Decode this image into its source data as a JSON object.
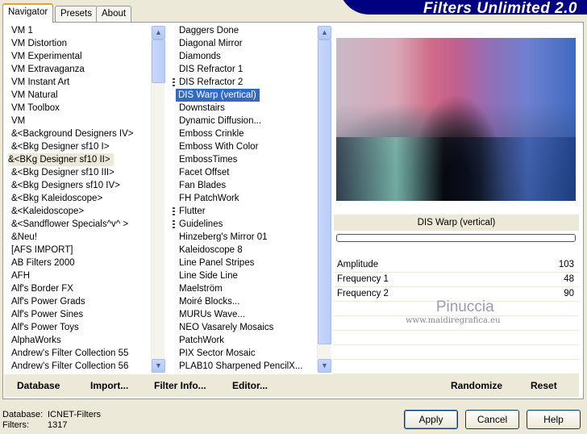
{
  "app_title": "Filters Unlimited 2.0",
  "tabs": [
    {
      "label": "Navigator",
      "active": true
    },
    {
      "label": "Presets"
    },
    {
      "label": "About"
    }
  ],
  "categories": [
    "VM 1",
    "VM Distortion",
    "VM Experimental",
    "VM Extravaganza",
    "VM Instant Art",
    "VM Natural",
    "VM Toolbox",
    "VM",
    "&<Background Designers IV>",
    "&<Bkg Designer sf10 I>",
    "&<BKg Designer sf10 II>",
    "&<Bkg Designer sf10 III>",
    "&<Bkg Designers sf10 IV>",
    "&<Bkg Kaleidoscope>",
    "&<Kaleidoscope>",
    "&<Sandflower Specials^v^ >",
    "&Neu!",
    "[AFS IMPORT]",
    "AB Filters 2000",
    "AFH",
    "Alf's Border FX",
    "Alf's Power Grads",
    "Alf's Power Sines",
    "Alf's Power Toys",
    "AlphaWorks",
    "Andrew's Filter Collection 55",
    "Andrew's Filter Collection 56"
  ],
  "selected_category": "&<BKg Designer sf10 II>",
  "filters": [
    {
      "label": "Daggers Done"
    },
    {
      "label": "Diagonal Mirror"
    },
    {
      "label": "Diamonds"
    },
    {
      "label": "DIS Refractor 1"
    },
    {
      "label": "DIS Refractor 2",
      "grip": true
    },
    {
      "label": "DIS Warp (vertical)",
      "selected": true
    },
    {
      "label": "Downstairs"
    },
    {
      "label": "Dynamic Diffusion..."
    },
    {
      "label": "Emboss Crinkle"
    },
    {
      "label": "Emboss With Color"
    },
    {
      "label": "EmbossTimes"
    },
    {
      "label": "Facet Offset"
    },
    {
      "label": "Fan Blades"
    },
    {
      "label": "FH PatchWork"
    },
    {
      "label": "Flutter",
      "grip": true
    },
    {
      "label": "Guidelines",
      "grip": true
    },
    {
      "label": "Hinzeberg's Mirror 01"
    },
    {
      "label": "Kaleidoscope 8"
    },
    {
      "label": "Line Panel Stripes"
    },
    {
      "label": "Line Side Line"
    },
    {
      "label": "Maelström"
    },
    {
      "label": "Moiré Blocks..."
    },
    {
      "label": "MURUs Wave..."
    },
    {
      "label": "NEO Vasarely Mosaics"
    },
    {
      "label": "PatchWork"
    },
    {
      "label": "PIX Sector Mosaic"
    },
    {
      "label": "PLAB10 Sharpened PencilX..."
    }
  ],
  "filter_name": "DIS Warp (vertical)",
  "progress": 0,
  "params": [
    {
      "name": "Amplitude",
      "value": "103"
    },
    {
      "name": "Frequency 1",
      "value": "48"
    },
    {
      "name": "Frequency 2",
      "value": "90"
    }
  ],
  "watermark": {
    "name": "Pinuccia",
    "url": "www.maidiregrafica.eu"
  },
  "bottom_buttons": {
    "database": "Database",
    "import": "Import...",
    "filter_info": "Filter Info...",
    "editor": "Editor...",
    "randomize": "Randomize",
    "reset": "Reset"
  },
  "footer": {
    "database_label": "Database:",
    "database_value": "ICNET-Filters",
    "filters_label": "Filters:",
    "filters_value": "1317"
  },
  "dialog_buttons": {
    "apply": "Apply",
    "cancel": "Cancel",
    "help": "Help"
  }
}
